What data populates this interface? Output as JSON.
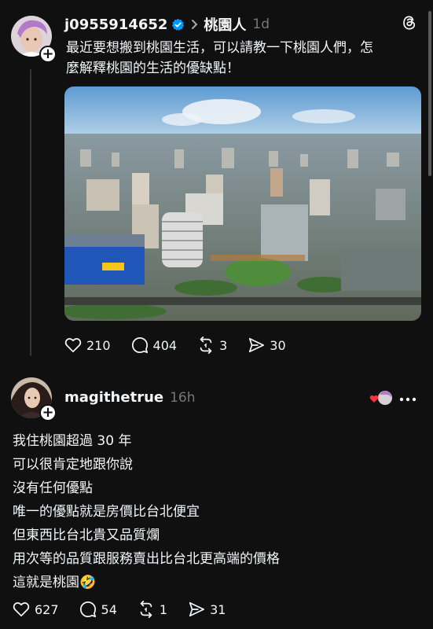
{
  "post": {
    "username": "j0955914652",
    "topic": "桃園人",
    "time": "1d",
    "text_lines": [
      "最近要想搬到桃園生活，可以請教一下桃園人們，怎",
      "麼解釋桃園的生活的優缺點！"
    ],
    "stats": {
      "likes": "210",
      "comments": "404",
      "reposts": "3",
      "shares": "30"
    }
  },
  "reply": {
    "username": "magithetrue",
    "time": "16h",
    "lines": [
      "我住桃園超過 30 年",
      "可以很肯定地跟你說",
      "沒有任何優點",
      "唯一的優點就是房價比台北便宜",
      "但東西比台北貴又品質爛",
      "用次等的品質跟服務賣出比台北更高端的價格",
      "這就是桃園🤣"
    ],
    "stats": {
      "likes": "627",
      "comments": "54",
      "reposts": "1",
      "shares": "31"
    }
  },
  "icons": {
    "verified": "verified-badge-icon",
    "threads_logo": "threads-logo-icon",
    "like": "heart-icon",
    "comment": "comment-icon",
    "repost": "repost-icon",
    "share": "share-icon",
    "more": "more-icon"
  },
  "colors": {
    "background": "#101010",
    "text": "#f3f5f7",
    "secondary": "#777777",
    "verified": "#0095f6",
    "heart": "#ff3040"
  }
}
